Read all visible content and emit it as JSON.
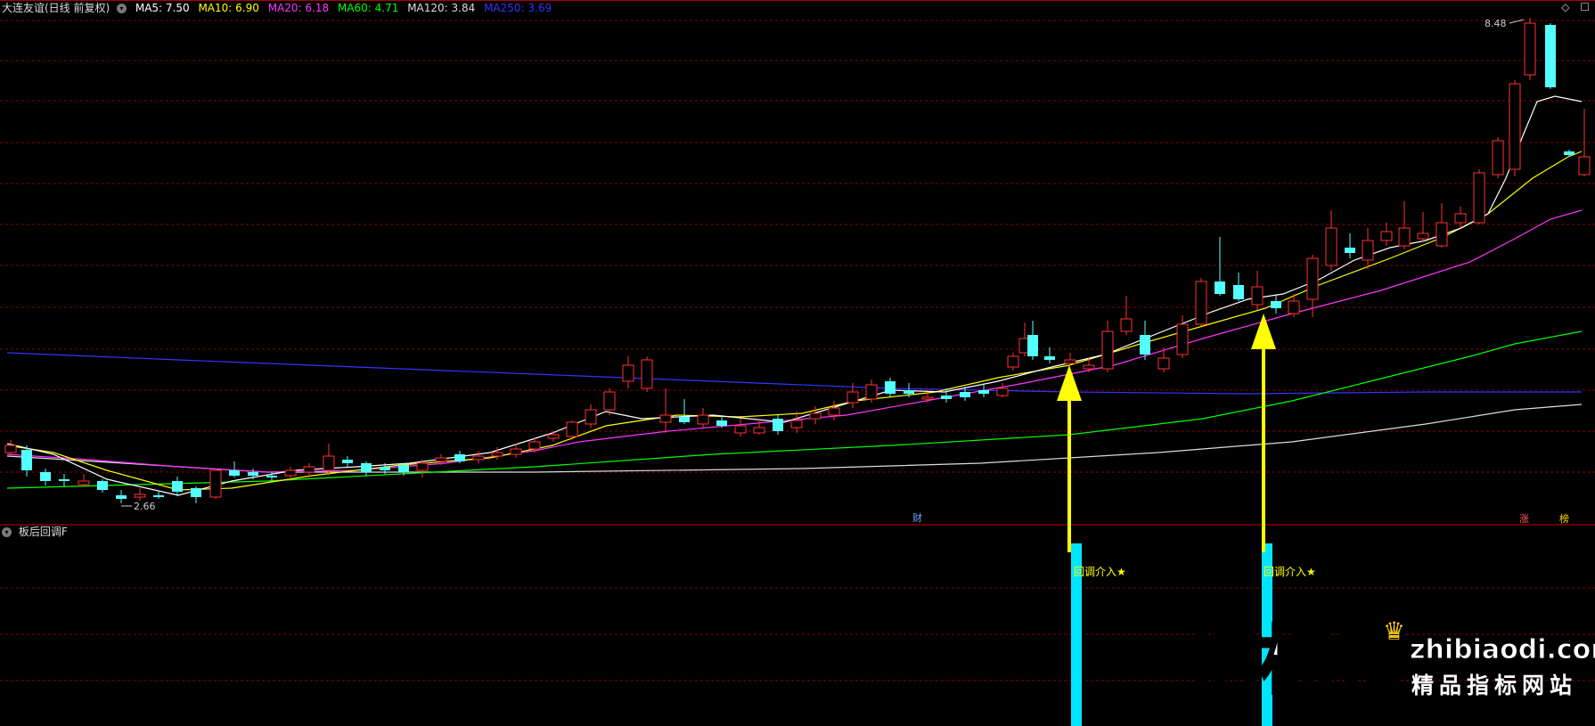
{
  "header": {
    "stock": "大连友谊(日线 前复权)",
    "ma": [
      {
        "label": "MA5: 7.50",
        "color": "#ffffff"
      },
      {
        "label": "MA10: 6.90",
        "color": "#ffff00"
      },
      {
        "label": "MA20: 6.18",
        "color": "#ff33ff"
      },
      {
        "label": "MA60: 4.71",
        "color": "#00ff00"
      },
      {
        "label": "MA120: 3.84",
        "color": "#dddddd"
      },
      {
        "label": "MA250: 3.69",
        "color": "#3333ff"
      }
    ],
    "collapse_icon": "chevron-down-icon"
  },
  "top_right": {
    "diamond_icon": "◇",
    "settings_icon": "☐"
  },
  "price_labels": {
    "high": "8.48",
    "low": "2.66"
  },
  "markers": {
    "cai": "财",
    "zhang": "涨",
    "jiang": "榜"
  },
  "indicator": {
    "name": "板后回调F",
    "signals": [
      "回调介入★",
      "回调介入★"
    ]
  },
  "watermark": {
    "big": "指标帝",
    "url": "zhibiaodi.com",
    "sub": "精品指标网站"
  },
  "colors": {
    "up": "#ff3232",
    "down": "#54ffff",
    "grid": "#8b0000",
    "arrow": "#ffff00",
    "signal_bar": "#00e5ff"
  }
}
